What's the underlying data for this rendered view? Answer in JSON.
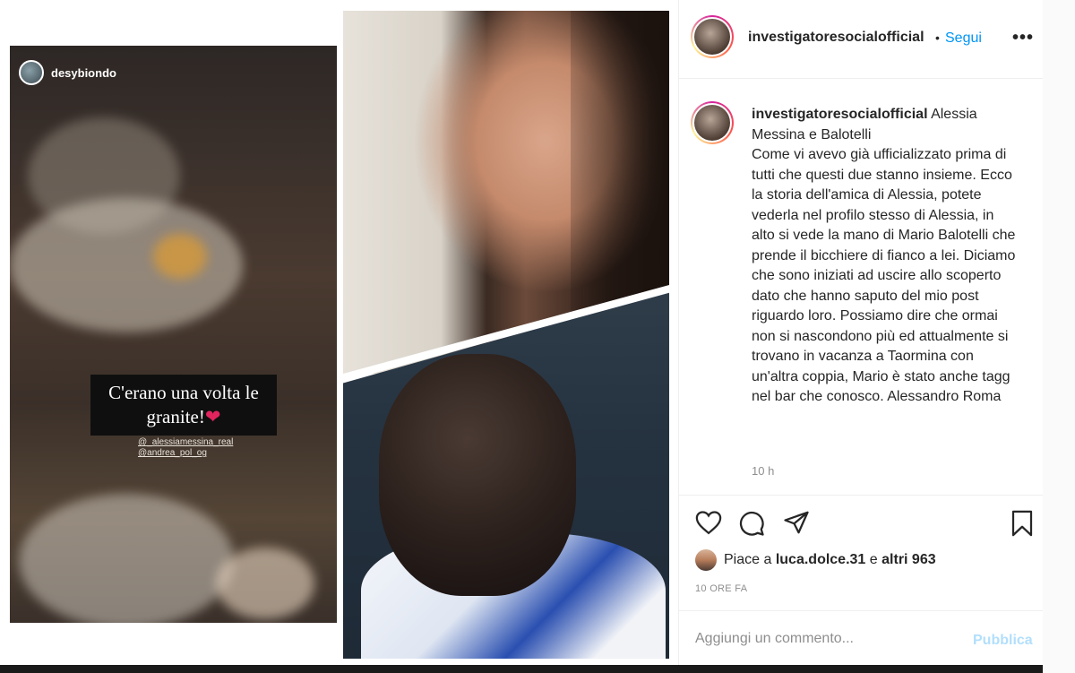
{
  "post": {
    "username": "investigatoresocialofficial",
    "separator": "•",
    "follow_label": "Segui",
    "more_label": "•••",
    "caption_username": "investigatoresocialofficial",
    "caption_text": "Alessia Messina e Balotelli\nCome vi avevo già ufficializzato prima di tutti che questi due stanno insieme. Ecco la storia dell'amica di Alessia, potete vederla nel profilo stesso di Alessia, in alto si vede la mano di Mario Balotelli che prende il bicchiere di fianco a lei. Diciamo che sono iniziati ad uscire allo scoperto dato che hanno saputo del mio post riguardo loro. Possiamo dire che ormai non si nascondono più ed attualmente si trovano in vacanza a Taormina con un'altra coppia, Mario è stato anche tagg nel bar che conosco. Alessandro Roma",
    "time_ago_short": "10 h",
    "likes_prefix": "Piace a",
    "likes_user": "luca.dolce.31",
    "likes_connector": "e",
    "likes_others": "altri 963",
    "time_ago_long": "10 ORE FA",
    "comment_placeholder": "Aggiungi un commento...",
    "publish_label": "Pubblica"
  },
  "story": {
    "username": "desybiondo",
    "caption": "C'erano una volta le granite!",
    "heart": "❤",
    "tag_1": "@_alessiamessina_real",
    "tag_2": "@andrea_pol_og"
  },
  "icons": {
    "like": "heart-icon",
    "comment": "comment-icon",
    "share": "share-icon",
    "save": "bookmark-icon",
    "more": "more-icon"
  },
  "colors": {
    "link_blue": "#0095f6",
    "publish_disabled": "#b2dffc",
    "secondary_text": "#8e8e8e"
  }
}
